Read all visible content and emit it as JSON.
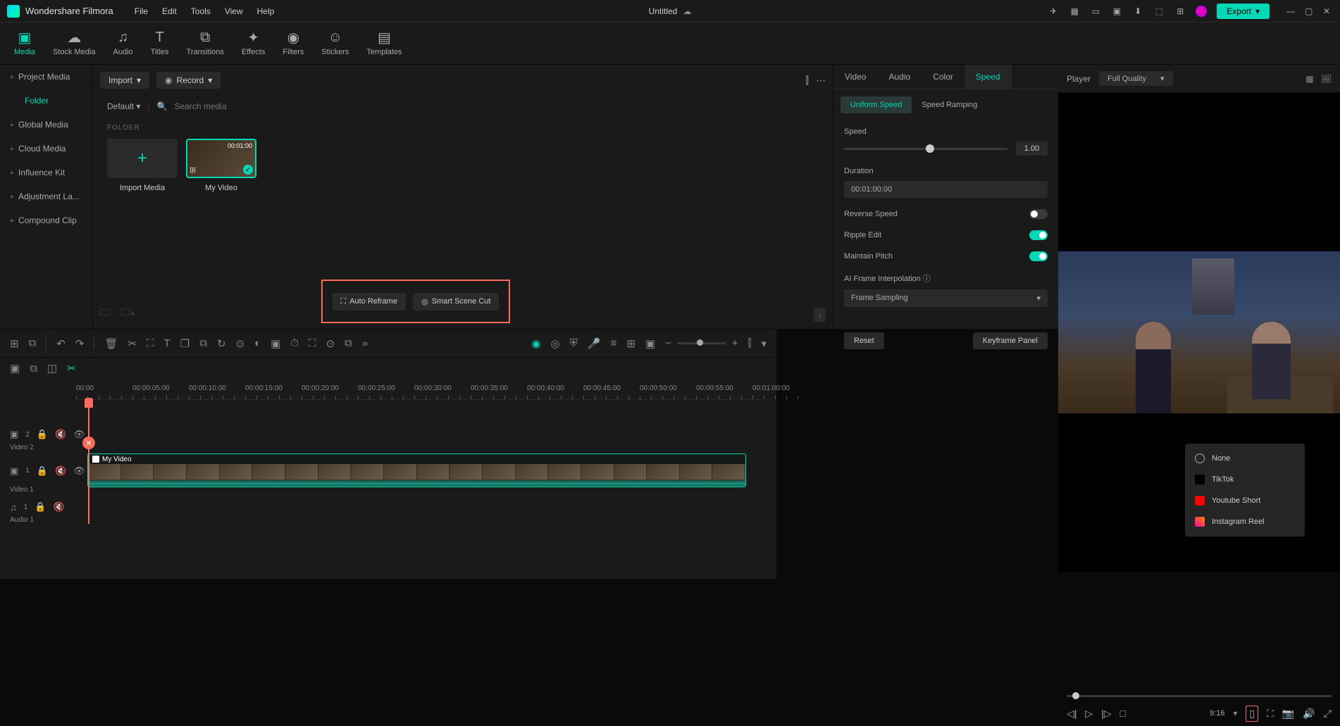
{
  "app": {
    "name": "Wondershare Filmora",
    "documentTitle": "Untitled"
  },
  "menuBar": [
    "File",
    "Edit",
    "Tools",
    "View",
    "Help"
  ],
  "exportLabel": "Export",
  "topTabs": [
    {
      "label": "Media",
      "active": true
    },
    {
      "label": "Stock Media"
    },
    {
      "label": "Audio"
    },
    {
      "label": "Titles"
    },
    {
      "label": "Transitions"
    },
    {
      "label": "Effects"
    },
    {
      "label": "Filters"
    },
    {
      "label": "Stickers"
    },
    {
      "label": "Templates"
    }
  ],
  "sidebar": {
    "items": [
      {
        "label": "Project Media"
      },
      {
        "label": "Folder",
        "active": true
      },
      {
        "label": "Global Media"
      },
      {
        "label": "Cloud Media"
      },
      {
        "label": "Influence Kit"
      },
      {
        "label": "Adjustment La..."
      },
      {
        "label": "Compound Clip"
      }
    ]
  },
  "mediaPanel": {
    "importLabel": "Import",
    "recordLabel": "Record",
    "defaultLabel": "Default",
    "searchPlaceholder": "Search media",
    "folderLabel": "FOLDER",
    "importMediaLabel": "Import Media",
    "clips": [
      {
        "name": "My Video",
        "duration": "00:01:00"
      }
    ],
    "autoReframeLabel": "Auto Reframe",
    "smartSceneCutLabel": "Smart Scene Cut"
  },
  "rightPanel": {
    "tabs": [
      "Video",
      "Audio",
      "Color",
      "Speed"
    ],
    "activeTab": "Speed",
    "subtabs": [
      "Uniform Speed",
      "Speed Ramping"
    ],
    "activeSubtab": "Uniform Speed",
    "speedLabel": "Speed",
    "speedValue": "1.00",
    "durationLabel": "Duration",
    "durationValue": "00:01:00:00",
    "reverseLabel": "Reverse Speed",
    "rippleLabel": "Ripple Edit",
    "pitchLabel": "Maintain Pitch",
    "aiFrameLabel": "AI Frame Interpolation",
    "aiFrameValue": "Frame Sampling",
    "resetLabel": "Reset",
    "keyframeLabel": "Keyframe Panel"
  },
  "player": {
    "title": "Player",
    "quality": "Full Quality",
    "aspectRatio": "9:16",
    "aspectMenu": [
      "None",
      "TikTok",
      "Youtube Short",
      "Instagram Reel"
    ]
  },
  "timeline": {
    "marks": [
      "00:00",
      "00:00:05:00",
      "00:00:10:00",
      "00:00:15:00",
      "00:00:20:00",
      "00:00:25:00",
      "00:00:30:00",
      "00:00:35:00",
      "00:00:40:00",
      "00:00:45:00",
      "00:00:50:00",
      "00:00:55:00",
      "00:01:00:00"
    ],
    "tracks": {
      "video2": "Video 2",
      "video1": "Video 1",
      "audio1": "Audio 1"
    },
    "clipTitle": "My Video",
    "trackHeadNums": {
      "v2": "2",
      "v1": "1",
      "a1": "1"
    }
  }
}
